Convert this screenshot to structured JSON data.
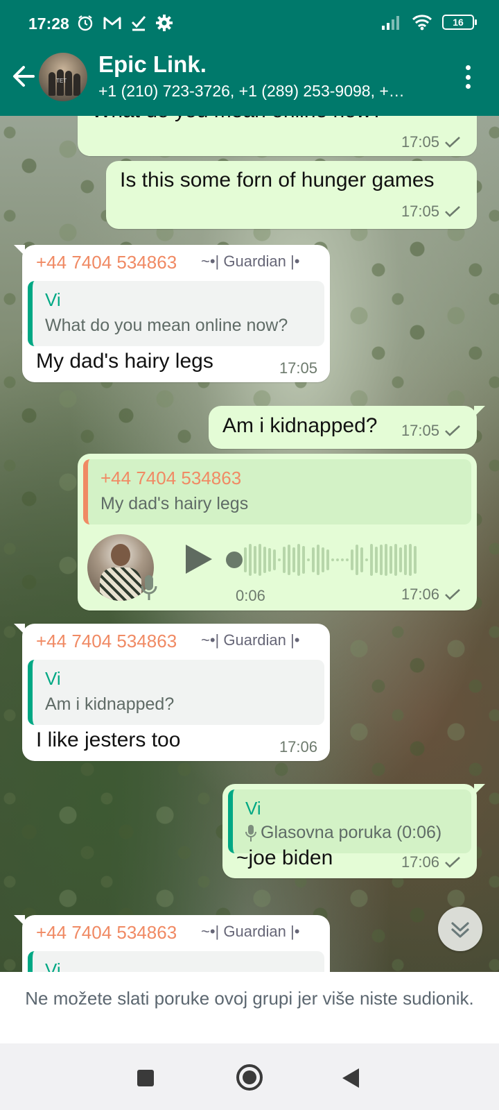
{
  "status": {
    "time": "17:28",
    "battery": "16",
    "icons": [
      "alarm-icon",
      "gmail-icon",
      "checkmark-icon",
      "settings-icon",
      "signal-icon",
      "wifi-icon",
      "battery-icon"
    ]
  },
  "header": {
    "title": "Epic Link.",
    "subtitle": "+1 (210) 723-3726, +1 (289) 253-9098, +…",
    "avatar_text": "TET"
  },
  "messages": [
    {
      "kind": "out",
      "text": "What do you mean online now?",
      "time": "17:05"
    },
    {
      "kind": "out",
      "text": "Is this some forn of hunger games",
      "time": "17:05"
    },
    {
      "kind": "in",
      "sender": "+44 7404 534863",
      "sender_tag": "~•| Guardian |•",
      "quote_author": "Vi",
      "quote_text": "What do you mean online now?",
      "text": "My dad's hairy legs",
      "time": "17:05"
    },
    {
      "kind": "out",
      "text": "Am i kidnapped?",
      "time": "17:05"
    },
    {
      "kind": "out_voice",
      "quote_author": "+44 7404 534863",
      "quote_text": "My dad's hairy legs",
      "duration": "0:06",
      "time": "17:06"
    },
    {
      "kind": "in",
      "sender": "+44 7404 534863",
      "sender_tag": "~•| Guardian |•",
      "quote_author": "Vi",
      "quote_text": "Am i kidnapped?",
      "text": "I like jesters too",
      "time": "17:06"
    },
    {
      "kind": "out",
      "quote_author": "Vi",
      "quote_text": "Glasovna poruka (0:06)",
      "text": "~joe biden",
      "time": "17:06"
    },
    {
      "kind": "in",
      "sender": "+44 7404 534863",
      "sender_tag": "~•| Guardian |•",
      "quote_author": "Vi"
    }
  ],
  "footer": {
    "notice": "Ne možete slati poruke ovoj grupi jer više niste sudionik."
  },
  "colors": {
    "header": "#00796b",
    "outgoing_bubble": "#e4fcd6",
    "incoming_bubble": "#ffffff",
    "sender_name": "#f08a64",
    "quote_author": "#00a884"
  }
}
